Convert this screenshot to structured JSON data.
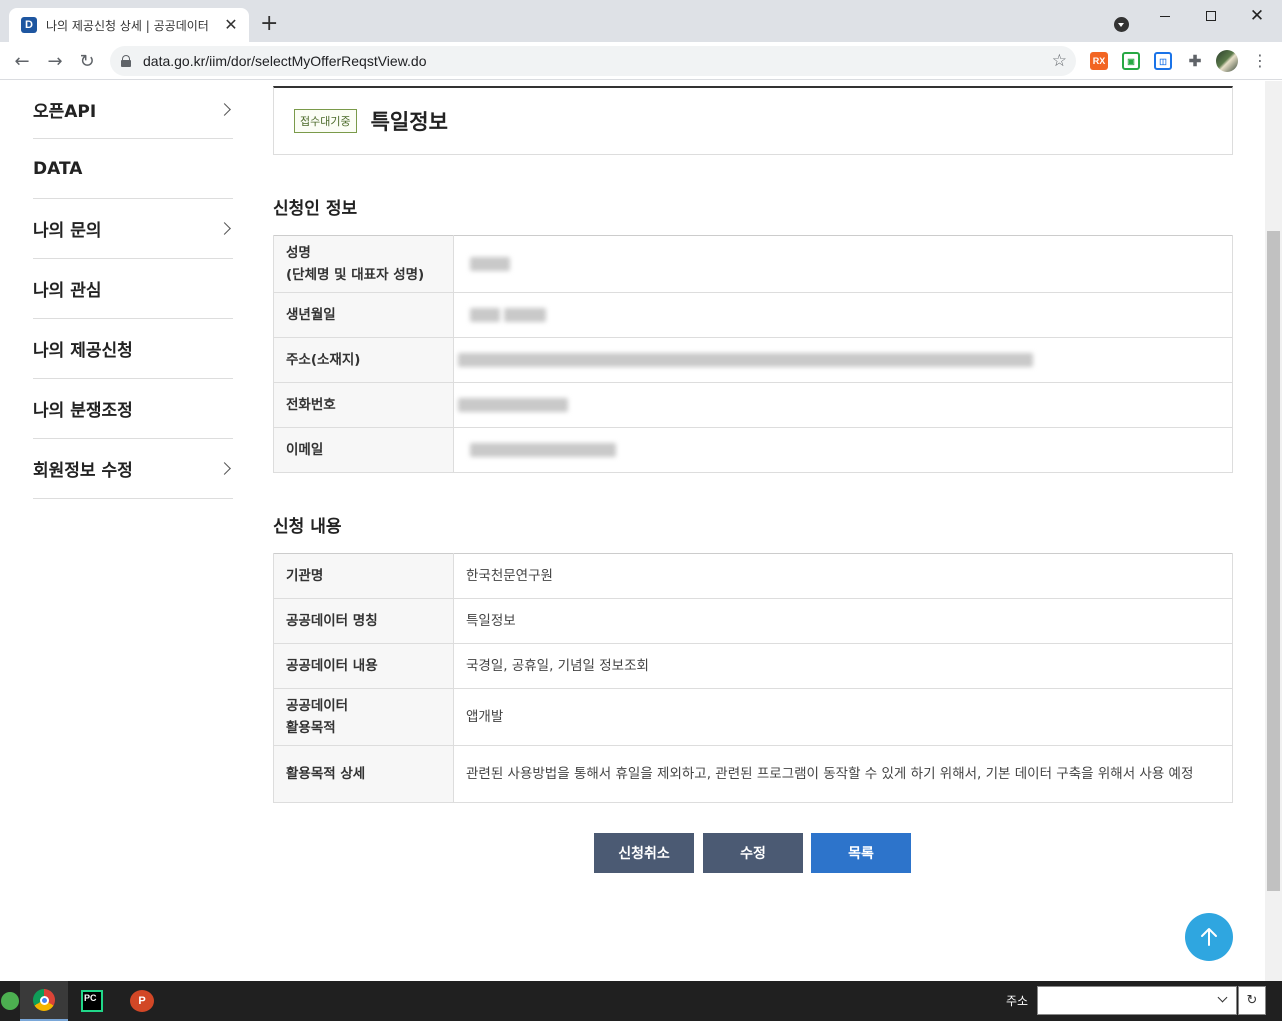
{
  "browser": {
    "tab_title": "나의 제공신청 상세 | 공공데이터",
    "favicon_letter": "D",
    "tab_close": "✕",
    "new_tab": "+",
    "url": "data.go.kr/iim/dor/selectMyOfferReqstView.do",
    "back": "←",
    "forward": "→",
    "reload": "↻",
    "star": "☆",
    "ext_1": "RX",
    "ext_2": "▣",
    "ext_3": "◫",
    "ext_4": "✚",
    "menu": "⋮",
    "window_close": "✕"
  },
  "sidebar": {
    "items": [
      {
        "label": "오픈API",
        "has_arrow": true
      },
      {
        "label": "DATA",
        "has_arrow": false
      },
      {
        "label": "나의 문의",
        "has_arrow": true
      },
      {
        "label": "나의 관심",
        "has_arrow": false
      },
      {
        "label": "나의 제공신청",
        "has_arrow": false
      },
      {
        "label": "나의 분쟁조정",
        "has_arrow": false
      },
      {
        "label": "회원정보 수정",
        "has_arrow": true
      }
    ]
  },
  "header": {
    "badge": "접수대기중",
    "title": "특일정보"
  },
  "applicant": {
    "section_title": "신청인 정보",
    "rows": [
      {
        "label_1": "성명",
        "label_2": "(단체명 및 대표자 성명)"
      },
      {
        "label_1": "생년월일"
      },
      {
        "label_1": "주소(소재지)"
      },
      {
        "label_1": "전화번호"
      },
      {
        "label_1": "이메일"
      }
    ]
  },
  "request": {
    "section_title": "신청 내용",
    "rows": [
      {
        "label_1": "기관명",
        "value": "한국천문연구원"
      },
      {
        "label_1": "공공데이터 명칭",
        "value": "특일정보"
      },
      {
        "label_1": "공공데이터 내용",
        "value": "국경일, 공휴일, 기념일 정보조회"
      },
      {
        "label_1": "공공데이터",
        "label_2": "활용목적",
        "value": "앱개발"
      },
      {
        "label_1": "활용목적 상세",
        "value": "관련된 사용방법을 통해서 휴일을 제외하고, 관련된 프로그램이 동작할 수 있게 하기 위해서, 기본 데이터 구축을 위해서 사용 예정"
      }
    ]
  },
  "actions": {
    "cancel": "신청취소",
    "edit": "수정",
    "list": "목록"
  },
  "taskbar": {
    "address_label": "주소",
    "pycharm": "PC",
    "ppt": "P",
    "refresh": "↻"
  },
  "colors": {
    "primary_button": "#2d74cb",
    "secondary_button": "#4b5a73",
    "scroll_top": "#2fa6e0"
  }
}
